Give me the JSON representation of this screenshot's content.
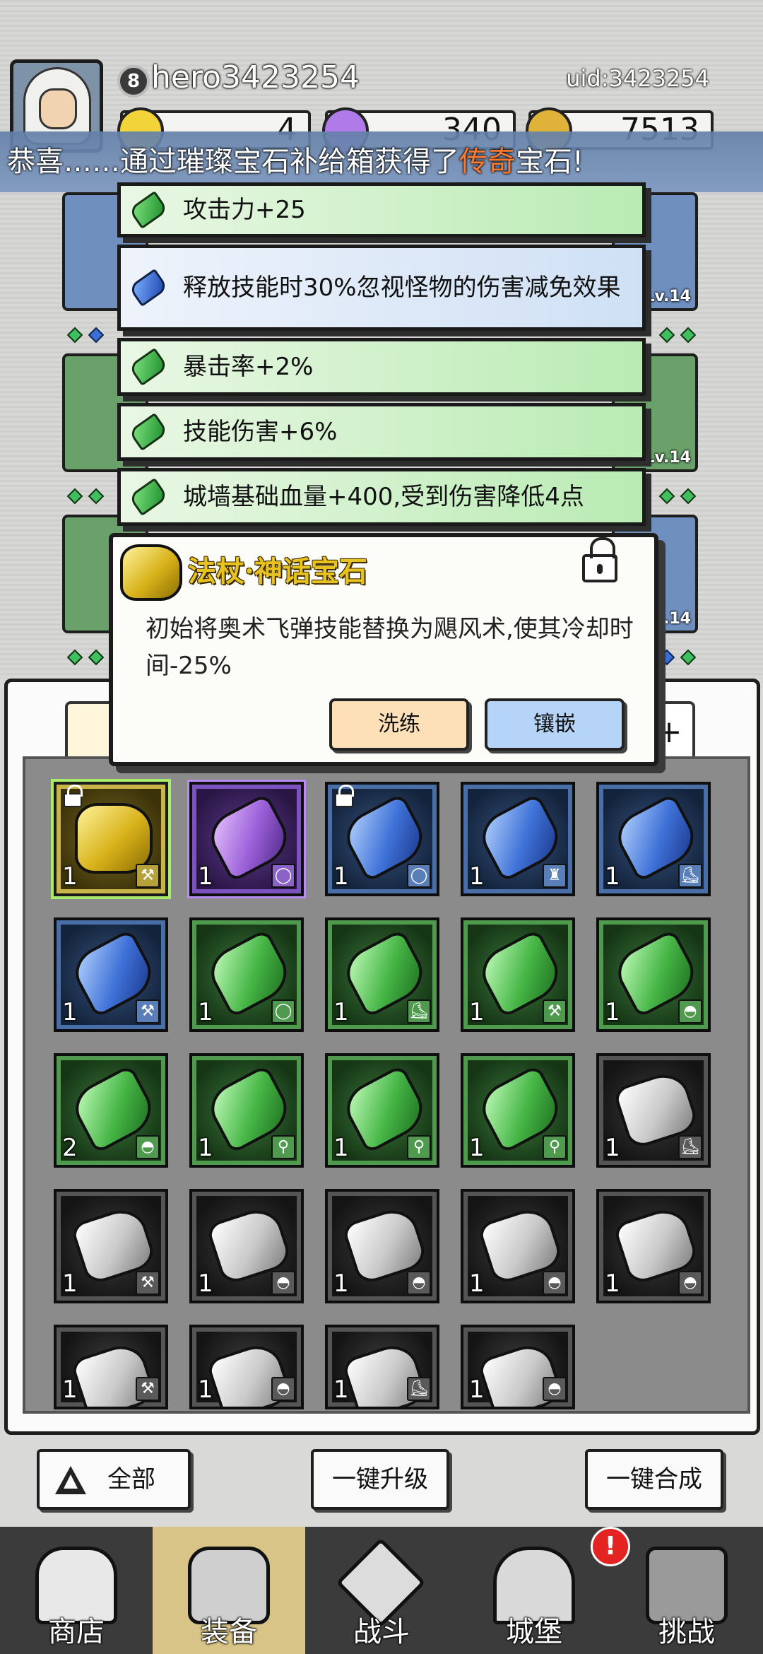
{
  "header": {
    "level": "8",
    "username": "hero3423254",
    "uid": "uid:3423254",
    "currencies": [
      {
        "name": "gold-gem",
        "value": "4"
      },
      {
        "name": "diamond",
        "value": "340"
      },
      {
        "name": "coin",
        "value": "7513"
      }
    ]
  },
  "toast": {
    "prefix": "恭喜……通过璀璨宝石补给箱获得了",
    "highlight": "传奇",
    "suffix": "宝石!"
  },
  "equip_levels": {
    "right_top": "Lv.14",
    "right_mid": "Lv.14",
    "right_bot": "Lv.14"
  },
  "stats": [
    {
      "text": "攻击力+25",
      "color": "green"
    },
    {
      "text": "释放技能时30%忽视怪物的伤害减免效果",
      "color": "blue"
    },
    {
      "text": "暴击率+2%",
      "color": "green"
    },
    {
      "text": "技能伤害+6%",
      "color": "green"
    },
    {
      "text": "城墙基础血量+400,受到伤害降低4点",
      "color": "green"
    }
  ],
  "popup": {
    "title": "法杖·神话宝石",
    "description": "初始将奥术飞弹技能替换为飓风术,使其冷却时间-25%",
    "refine_label": "洗练",
    "inlay_label": "镶嵌"
  },
  "tabs": {
    "plus_label": "+"
  },
  "inventory": [
    {
      "rarity": "legendary",
      "gem": "gold",
      "count": "1",
      "slot": "staff",
      "locked": true
    },
    {
      "rarity": "epic",
      "gem": "purple",
      "count": "1",
      "slot": "ring",
      "locked": false
    },
    {
      "rarity": "rare",
      "gem": "blue",
      "count": "1",
      "slot": "ring",
      "locked": true
    },
    {
      "rarity": "rare",
      "gem": "blue",
      "count": "1",
      "slot": "armor",
      "locked": false
    },
    {
      "rarity": "rare",
      "gem": "blue",
      "count": "1",
      "slot": "boots",
      "locked": false
    },
    {
      "rarity": "rare",
      "gem": "blue",
      "count": "1",
      "slot": "staff",
      "locked": false
    },
    {
      "rarity": "uncommon",
      "gem": "green",
      "count": "1",
      "slot": "ring",
      "locked": false
    },
    {
      "rarity": "uncommon",
      "gem": "green",
      "count": "1",
      "slot": "boots",
      "locked": false
    },
    {
      "rarity": "uncommon",
      "gem": "green",
      "count": "1",
      "slot": "staff",
      "locked": false
    },
    {
      "rarity": "uncommon",
      "gem": "green",
      "count": "1",
      "slot": "hat",
      "locked": false
    },
    {
      "rarity": "uncommon",
      "gem": "green",
      "count": "2",
      "slot": "hat",
      "locked": false
    },
    {
      "rarity": "uncommon",
      "gem": "green",
      "count": "1",
      "slot": "amulet",
      "locked": false
    },
    {
      "rarity": "uncommon",
      "gem": "green",
      "count": "1",
      "slot": "amulet",
      "locked": false
    },
    {
      "rarity": "uncommon",
      "gem": "green",
      "count": "1",
      "slot": "amulet",
      "locked": false
    },
    {
      "rarity": "common",
      "gem": "white",
      "count": "1",
      "slot": "boots",
      "locked": false
    },
    {
      "rarity": "common",
      "gem": "white",
      "count": "1",
      "slot": "staff",
      "locked": false
    },
    {
      "rarity": "common",
      "gem": "white",
      "count": "1",
      "slot": "hat",
      "locked": false
    },
    {
      "rarity": "common",
      "gem": "white",
      "count": "1",
      "slot": "hat",
      "locked": false
    },
    {
      "rarity": "common",
      "gem": "white",
      "count": "1",
      "slot": "hat",
      "locked": false
    },
    {
      "rarity": "common",
      "gem": "white",
      "count": "1",
      "slot": "hat",
      "locked": false
    },
    {
      "rarity": "common",
      "gem": "white",
      "count": "1",
      "slot": "staff",
      "locked": false
    },
    {
      "rarity": "common",
      "gem": "white",
      "count": "1",
      "slot": "hat",
      "locked": false
    },
    {
      "rarity": "common",
      "gem": "white",
      "count": "1",
      "slot": "boots",
      "locked": false
    },
    {
      "rarity": "common",
      "gem": "white",
      "count": "1",
      "slot": "hat",
      "locked": false
    }
  ],
  "actions": {
    "filter_label": "全部",
    "upgrade_label": "一键升级",
    "merge_label": "一键合成"
  },
  "nav": [
    {
      "label": "商店",
      "active": false
    },
    {
      "label": "装备",
      "active": true
    },
    {
      "label": "战斗",
      "active": false
    },
    {
      "label": "城堡",
      "active": false
    },
    {
      "label": "挑战",
      "active": false
    }
  ],
  "nav_alert": "!",
  "colors": {
    "legendary_text": "#ff7a2e",
    "popup_title": "#e8c21f",
    "active_nav": "#d8c486"
  }
}
